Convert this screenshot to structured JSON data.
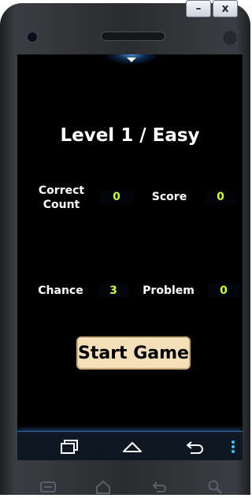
{
  "window": {
    "minimize_label": "–",
    "close_label": "x"
  },
  "game": {
    "level_title": "Level 1 / Easy",
    "correct_count_label_line1": "Correct",
    "correct_count_label_line2": "Count",
    "correct_count_value": "0",
    "score_label": "Score",
    "score_value": "0",
    "chance_label": "Chance",
    "chance_value": "3",
    "problem_label": "Problem",
    "problem_value": "0",
    "start_button_label": "Start Game"
  },
  "colors": {
    "screen_bg": "#000000",
    "value_text": "#c8ff2e",
    "button_bg": "#f4dfb8",
    "nav_glow": "#2a6aa8"
  },
  "icons": {
    "nav": [
      "recent-apps-icon",
      "home-icon",
      "back-icon",
      "overflow-menu-icon"
    ],
    "hardware": [
      "menu-icon",
      "home-icon",
      "back-icon",
      "search-icon"
    ]
  }
}
